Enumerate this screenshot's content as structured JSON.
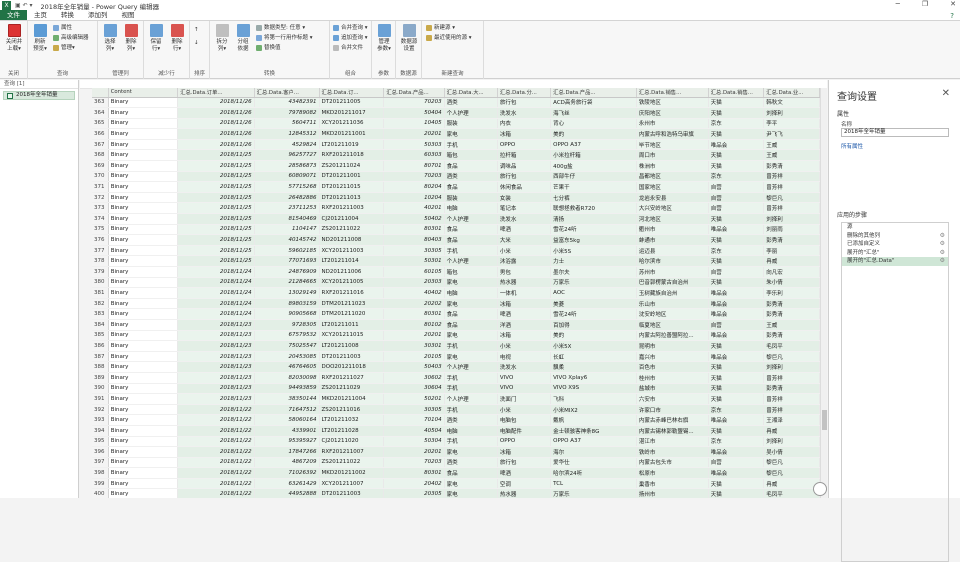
{
  "window": {
    "title": "2018年全年销量 - Power Query 编辑器",
    "app_icon": "X"
  },
  "tabs": [
    {
      "label": "文件"
    },
    {
      "label": "主页"
    },
    {
      "label": "转换"
    },
    {
      "label": "添加列"
    },
    {
      "label": "视图"
    }
  ],
  "ribbon": {
    "close": {
      "l1": "关闭并",
      "l2": "上载▾",
      "group": "关闭"
    },
    "query": {
      "refresh_l1": "刷新",
      "refresh_l2": "预览▾",
      "props": "属性",
      "adv": "高级编辑器",
      "manage": "管理▾",
      "group": "查询"
    },
    "cols": {
      "choose_l1": "选择",
      "choose_l2": "列▾",
      "remove_l1": "删除",
      "remove_l2": "列▾",
      "group": "管理列"
    },
    "rows": {
      "keep_l1": "保留",
      "keep_l2": "行▾",
      "del_l1": "删除",
      "del_l2": "行▾",
      "group": "减少行"
    },
    "sort": {
      "group": "排序"
    },
    "transform": {
      "split_l1": "拆分",
      "split_l2": "列▾",
      "groupby_l1": "分组",
      "groupby_l2": "依据",
      "dtype": "数据类型: 任意 ▾",
      "firstrow": "将第一行用作标题 ▾",
      "replace": "替换值",
      "group": "转换"
    },
    "combine": {
      "merge": "合并查询 ▾",
      "append": "追加查询 ▾",
      "files": "合并文件",
      "group": "组合"
    },
    "params": {
      "l1": "管理",
      "l2": "参数▾",
      "group": "参数"
    },
    "source": {
      "l1": "数据源",
      "l2": "设置",
      "group": "数据源"
    },
    "newq": {
      "new": "新建源 ▾",
      "recent": "最近使用的源 ▾",
      "group": "新建查询"
    }
  },
  "queries": {
    "header": "查询 [1]",
    "item": "2018年全年销量"
  },
  "columns": [
    "",
    "Content",
    "汇总.Data.订单...",
    "汇总.Data.客户...",
    "汇总.Data.订...",
    "汇总.Data.产品...",
    "汇总.Data.大...",
    "汇总.Data.分...",
    "汇总.Data.产品...",
    "汇总.Data.销售...",
    "汇总.Data.销售...",
    "汇总.Data.业..."
  ],
  "rows": [
    [
      "363",
      "Binary",
      "2018/11/26",
      "43482391",
      "DT201211005",
      "70203",
      "酒类",
      "旅行包",
      "ACD高务旅行袋",
      "铁陵地区",
      "天猫",
      "韩秋文"
    ],
    [
      "364",
      "Binary",
      "2018/11/26",
      "79789082",
      "MKD201211017",
      "50404",
      "个人护理",
      "洗发水",
      "海飞丝",
      "庆阳地区",
      "天猫",
      "刘择利"
    ],
    [
      "365",
      "Binary",
      "2018/11/26",
      "5604711",
      "XCY201211036",
      "10405",
      "服装",
      "内衣",
      "背心",
      "永州市",
      "京东",
      "李平"
    ],
    [
      "366",
      "Binary",
      "2018/11/26",
      "12845312",
      "MKD201211001",
      "20201",
      "家电",
      "冰箱",
      "美的",
      "内蒙古呼和浩特乌审旗",
      "天猫",
      "尹飞飞"
    ],
    [
      "367",
      "Binary",
      "2018/11/26",
      "4529824",
      "LT201211019",
      "50303",
      "手机",
      "OPPO",
      "OPPO A37",
      "毕节地区",
      "唯品会",
      "王威"
    ],
    [
      "368",
      "Binary",
      "2018/11/25",
      "96257727",
      "RXF201211018",
      "60303",
      "箱包",
      "拉杆箱",
      "小米拉杆箱",
      "周口市",
      "天猫",
      "王威"
    ],
    [
      "369",
      "Binary",
      "2018/11/25",
      "28586873",
      "ZS201211024",
      "80701",
      "食品",
      "调味品",
      "400g盐",
      "株洲市",
      "天猫",
      "彭秀清"
    ],
    [
      "370",
      "Binary",
      "2018/11/25",
      "60809071",
      "DT201211001",
      "70203",
      "酒类",
      "旅行包",
      "西部牛仔",
      "昌都地区",
      "京东",
      "曾芳祥"
    ],
    [
      "371",
      "Binary",
      "2018/11/25",
      "57715268",
      "DT201211015",
      "80204",
      "食品",
      "休闲食品",
      "芒果干",
      "国家地区",
      "自营",
      "曾芳祥"
    ],
    [
      "372",
      "Binary",
      "2018/11/25",
      "26482886",
      "DT201211013",
      "10204",
      "服装",
      "女装",
      "七分裤",
      "龙岩永安县",
      "自营",
      "黎巨凡"
    ],
    [
      "373",
      "Binary",
      "2018/11/25",
      "23711253",
      "RXF201211003",
      "40201",
      "电脑",
      "笔记本",
      "联想拯救者R720",
      "大兴安岭地区",
      "自营",
      "曾芳祥"
    ],
    [
      "374",
      "Binary",
      "2018/11/25",
      "81540469",
      "CJ201211004",
      "50402",
      "个人护理",
      "洗发水",
      "清扬",
      "河北地区",
      "天猫",
      "刘择利"
    ],
    [
      "375",
      "Binary",
      "2018/11/25",
      "1104147",
      "ZS201211022",
      "80301",
      "食品",
      "啤酒",
      "雪花24听",
      "衢州市",
      "唯品会",
      "刘丽雨"
    ],
    [
      "376",
      "Binary",
      "2018/11/25",
      "40145742",
      "ND201211008",
      "80403",
      "食品",
      "大米",
      "益富东5kg",
      "蚌通市",
      "天猫",
      "彭秀清"
    ],
    [
      "377",
      "Binary",
      "2018/11/25",
      "59602185",
      "XCY201211003",
      "30305",
      "手机",
      "小米",
      "小米5S",
      "运迈县",
      "京东",
      "李丽"
    ],
    [
      "378",
      "Binary",
      "2018/11/25",
      "77071693",
      "LT201211014",
      "50301",
      "个人护理",
      "沐浴露",
      "力士",
      "哈尔滨市",
      "天猫",
      "冉威"
    ],
    [
      "379",
      "Binary",
      "2018/11/24",
      "24876909",
      "ND201211006",
      "60105",
      "箱包",
      "男包",
      "墨尔夫",
      "苏州市",
      "自营",
      "向凡宏"
    ],
    [
      "380",
      "Binary",
      "2018/11/24",
      "21284665",
      "XCY201211005",
      "20303",
      "家电",
      "热水器",
      "万家乐",
      "巴音郭楞蒙古自治州",
      "天猫",
      "朱小倩"
    ],
    [
      "381",
      "Binary",
      "2018/11/24",
      "13029149",
      "RXF201211016",
      "40402",
      "电脑",
      "一体机",
      "AOC",
      "玉树藏族自治州",
      "唯品会",
      "李乐利"
    ],
    [
      "382",
      "Binary",
      "2018/11/24",
      "89803159",
      "DTM201211023",
      "20202",
      "家电",
      "冰箱",
      "美菱",
      "乐山市",
      "唯品会",
      "彭秀清"
    ],
    [
      "383",
      "Binary",
      "2018/11/24",
      "90905668",
      "DTM201211020",
      "80301",
      "食品",
      "啤酒",
      "雪花24听",
      "沈安岭地区",
      "唯品会",
      "彭秀清"
    ],
    [
      "384",
      "Binary",
      "2018/11/23",
      "9728305",
      "LT201211011",
      "80102",
      "食品",
      "洋酒",
      "百加得",
      "临夏地区",
      "自营",
      "王威"
    ],
    [
      "385",
      "Binary",
      "2018/11/23",
      "67579532",
      "XCY201211015",
      "20201",
      "家电",
      "冰箱",
      "美的",
      "内蒙古阿拉善盟阿拉...",
      "唯品会",
      "彭秀清"
    ],
    [
      "386",
      "Binary",
      "2018/11/23",
      "75025547",
      "LT201211008",
      "30301",
      "手机",
      "小米",
      "小米5X",
      "昆明市",
      "天猫",
      "毛凤平"
    ],
    [
      "387",
      "Binary",
      "2018/11/23",
      "20453085",
      "DT201211003",
      "20105",
      "家电",
      "电视",
      "长虹",
      "嘉兴市",
      "唯品会",
      "黎巨凡"
    ],
    [
      "388",
      "Binary",
      "2018/11/23",
      "46764605",
      "DOO201211018",
      "50403",
      "个人护理",
      "洗发水",
      "飘柔",
      "百色市",
      "天猫",
      "刘择利"
    ],
    [
      "389",
      "Binary",
      "2018/11/23",
      "82030098",
      "RXF201211027",
      "30602",
      "手机",
      "VIVO",
      "VIVO Xplay6",
      "桂州市",
      "天猫",
      "曾芳祥"
    ],
    [
      "390",
      "Binary",
      "2018/11/23",
      "94493859",
      "ZS201211029",
      "30604",
      "手机",
      "VIVO",
      "VIVO X9S",
      "盐城市",
      "天猫",
      "彭秀清"
    ],
    [
      "391",
      "Binary",
      "2018/11/23",
      "38350144",
      "MKD201211004",
      "50201",
      "个人护理",
      "洗面门",
      "飞科",
      "六安市",
      "天猫",
      "曾芳祥"
    ],
    [
      "392",
      "Binary",
      "2018/11/22",
      "71647512",
      "ZS201211016",
      "30305",
      "手机",
      "小米",
      "小米MIX2",
      "许家口市",
      "京东",
      "曾芳祥"
    ],
    [
      "393",
      "Binary",
      "2018/11/22",
      "58060164",
      "LT201211032",
      "70104",
      "酒类",
      "电脑包",
      "戴帆",
      "内蒙古赤峰巴林右旗",
      "唯品会",
      "王湘泽"
    ],
    [
      "394",
      "Binary",
      "2018/11/22",
      "4339901",
      "LT201211028",
      "40504",
      "电脑",
      "电脑配件",
      "金士顿骇客神条8G",
      "内蒙古锡林郭勒盟锡...",
      "天猫",
      "冉威"
    ],
    [
      "395",
      "Binary",
      "2018/11/22",
      "95395927",
      "CJ201211020",
      "50304",
      "手机",
      "OPPO",
      "OPPO A37",
      "湛江市",
      "京东",
      "刘择利"
    ],
    [
      "396",
      "Binary",
      "2018/11/22",
      "17847266",
      "RXF201211007",
      "20201",
      "家电",
      "冰箱",
      "海尔",
      "铁岭市",
      "唯品会",
      "吴小倩"
    ],
    [
      "397",
      "Binary",
      "2018/11/22",
      "4867209",
      "ZS201211022",
      "70203",
      "酒类",
      "旅行包",
      "爱华仕",
      "内蒙古包头市",
      "自营",
      "黎巨凡"
    ],
    [
      "398",
      "Binary",
      "2018/11/22",
      "71026392",
      "MKD201211002",
      "80301",
      "食品",
      "啤酒",
      "哈尔滨24听",
      "松原市",
      "唯品会",
      "黎巨凡"
    ],
    [
      "399",
      "Binary",
      "2018/11/22",
      "63261429",
      "XCY201211007",
      "20402",
      "家电",
      "空调",
      "TCL",
      "巢香市",
      "天猫",
      "冉威"
    ],
    [
      "400",
      "Binary",
      "2018/11/22",
      "44952888",
      "DT201211003",
      "20305",
      "家电",
      "热水器",
      "万家乐",
      "扬州市",
      "天猫",
      "毛凤平"
    ]
  ],
  "settings": {
    "title": "查询设置",
    "close": "✕",
    "props_section": "属性",
    "name_label": "名称",
    "name_value": "2018年全年销量",
    "all_props": "所有属性",
    "steps_section": "应用的步骤",
    "steps": [
      {
        "label": "源"
      },
      {
        "label": "删除的其他列"
      },
      {
        "label": "已添加自定义"
      },
      {
        "label": "展开的\"汇总\""
      },
      {
        "label": "展开的\"汇总.Data\""
      }
    ]
  }
}
